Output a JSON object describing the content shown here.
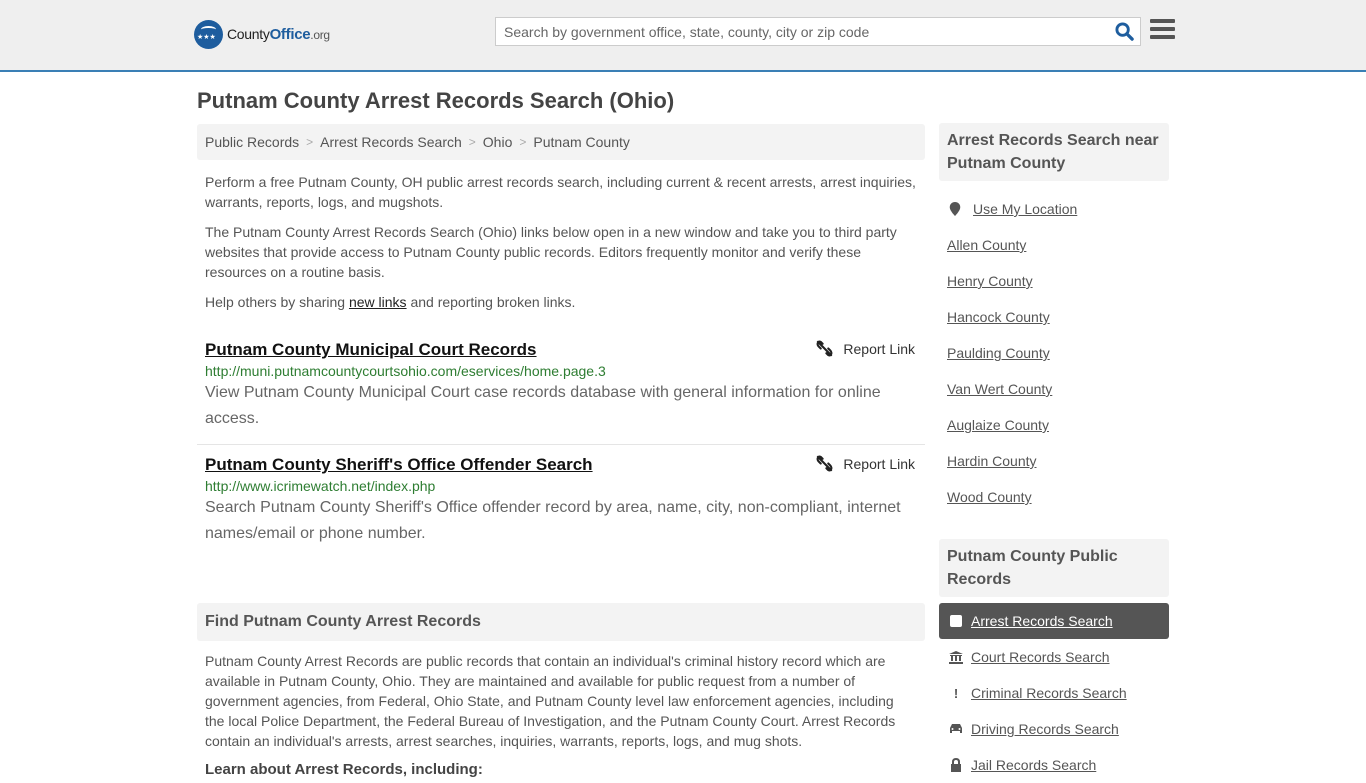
{
  "header": {
    "logo": {
      "county": "County",
      "office": "Office",
      "org": ".org"
    },
    "search_placeholder": "Search by government office, state, county, city or zip code",
    "search_value": ""
  },
  "page_title": "Putnam County Arrest Records Search (Ohio)",
  "breadcrumb": [
    "Public Records",
    "Arrest Records Search",
    "Ohio",
    "Putnam County"
  ],
  "breadcrumb_sep": ">",
  "intro": {
    "p1": "Perform a free Putnam County, OH public arrest records search, including current & recent arrests, arrest inquiries, warrants, reports, logs, and mugshots.",
    "p2": "The Putnam County Arrest Records Search (Ohio) links below open in a new window and take you to third party websites that provide access to Putnam County public records. Editors frequently monitor and verify these resources on a routine basis.",
    "p3_before": "Help others by sharing ",
    "p3_link": "new links",
    "p3_after": " and reporting broken links."
  },
  "links": [
    {
      "title": "Putnam County Municipal Court Records",
      "url": "http://muni.putnamcountycourtsohio.com/eservices/home.page.3",
      "description": "View Putnam County Municipal Court case records database with general information for online access.",
      "report_label": "Report Link"
    },
    {
      "title": "Putnam County Sheriff's Office Offender Search",
      "url": "http://www.icrimewatch.net/index.php",
      "description": "Search Putnam County Sheriff's Office offender record by area, name, city, non-compliant, internet names/email or phone number.",
      "report_label": "Report Link"
    }
  ],
  "find_section": {
    "heading": "Find Putnam County Arrest Records",
    "body": "Putnam County Arrest Records are public records that contain an individual's criminal history record which are available in Putnam County, Ohio. They are maintained and available for public request from a number of government agencies, from Federal, Ohio State, and Putnam County level law enforcement agencies, including the local Police Department, the Federal Bureau of Investigation, and the Putnam County Court. Arrest Records contain an individual's arrests, arrest searches, inquiries, warrants, reports, logs, and mug shots.",
    "learn_heading": "Learn about Arrest Records, including:"
  },
  "sidebar": {
    "nearby_heading": "Arrest Records Search near Putnam County",
    "use_location": "Use My Location",
    "nearby": [
      "Allen County",
      "Henry County",
      "Hancock County",
      "Paulding County",
      "Van Wert County",
      "Auglaize County",
      "Hardin County",
      "Wood County"
    ],
    "records_heading": "Putnam County Public Records",
    "records": [
      {
        "label": "Arrest Records Search",
        "icon": "square-icon",
        "active": true
      },
      {
        "label": "Court Records Search",
        "icon": "courthouse-icon",
        "active": false
      },
      {
        "label": "Criminal Records Search",
        "icon": "exclamation-icon",
        "active": false
      },
      {
        "label": "Driving Records Search",
        "icon": "car-icon",
        "active": false
      },
      {
        "label": "Jail Records Search",
        "icon": "lock-icon",
        "active": false
      }
    ]
  },
  "colors": {
    "accent": "#3a7fb5",
    "brand": "#1e5d9e",
    "url_green": "#2e7d32",
    "active_bg": "#555555"
  }
}
